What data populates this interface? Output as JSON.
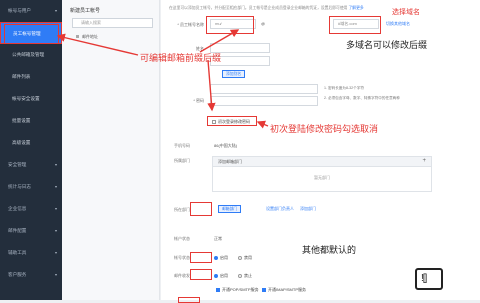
{
  "sidebar": {
    "items": [
      {
        "label": "帐号与用户",
        "type": "group"
      },
      {
        "label": "员工帐号管理",
        "type": "sub",
        "active": true
      },
      {
        "label": "公共邮箱及管理",
        "type": "sub"
      },
      {
        "label": "邮件列表",
        "type": "sub"
      },
      {
        "label": "帐号安全设置",
        "type": "sub"
      },
      {
        "label": "批量设置",
        "type": "sub"
      },
      {
        "label": "高级设置",
        "type": "sub"
      },
      {
        "label": "安全管理",
        "type": "group"
      },
      {
        "label": "统计与日志",
        "type": "group"
      },
      {
        "label": "企业信息",
        "type": "group"
      },
      {
        "label": "邮件配置",
        "type": "group"
      },
      {
        "label": "辅助工具",
        "type": "group"
      },
      {
        "label": "客户服务",
        "type": "group"
      }
    ]
  },
  "tree": {
    "title": "新建员工帐号",
    "search_placeholder": "请输入搜索",
    "root": "邮件地址"
  },
  "main": {
    "hint": "在这里可以添加员工帐号，并分配至相应部门。员工帐号是企业成员登录企业邮箱的凭证，设置后即可使用",
    "hint_link": "了解更多",
    "form": {
      "account_label": "* 员工帐号名称",
      "account_value": "mu/",
      "domain_value": "#域名.com",
      "domain_link": "切换其他域名",
      "name_label": "姓名",
      "alias_link": "添加别名",
      "password_label": "* 密码",
      "password_tip1": "1. 密码长度为8-32个字符",
      "password_tip2": "2. 必须包含字母、数字、特殊字符中的任意两种",
      "force_change_label": "初次登录修改密码",
      "phone_label": "手机号码",
      "phone_value": "86(中国大陆)",
      "dept_label": "所属部门",
      "dept_panel_header": "添加邮箱部门",
      "dept_panel_empty": "暂无部门",
      "position_label": "所在部门",
      "position_value": "邮箱部门",
      "position_link": "设置部门负责人",
      "position_link2": "添加部门",
      "account_type_label": "帐户状态",
      "account_type_value": "正常",
      "status_label": "帐号状态",
      "status_on": "启用",
      "status_off": "禁用",
      "smtp_label": "邮件收发",
      "smtp_on": "启用",
      "smtp_off": "禁止",
      "service1": "开通POP/SMTP服务",
      "service2": "开通IMAP/SMTP服务"
    }
  },
  "annotations": {
    "edit_prefix": "可编辑邮箱前缀后缀",
    "domain_select": "选择域名",
    "multi_domain": "多域名可以修改后缀",
    "first_login": "初次登陆修改密码勾选取消",
    "others_default": "其他都默认的"
  },
  "watermark": {
    "text": "![]"
  },
  "colors": {
    "accent": "#2f7cf6",
    "annotation": "#e53935",
    "sidebar": "#232e3c"
  }
}
